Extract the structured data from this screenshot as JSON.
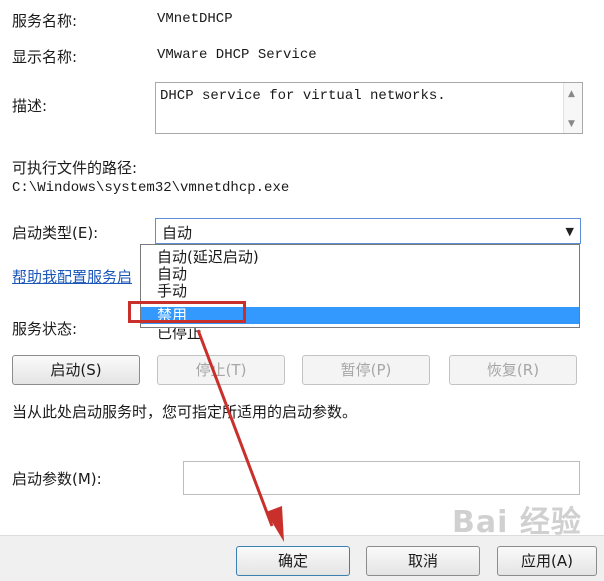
{
  "fields": {
    "service_name_label": "服务名称:",
    "service_name_value": "VMnetDHCP",
    "display_name_label": "显示名称:",
    "display_name_value": "VMware DHCP Service",
    "description_label": "描述:",
    "description_value": "DHCP service for virtual networks.",
    "path_label": "可执行文件的路径:",
    "path_value": "C:\\Windows\\system32\\vmnetdhcp.exe",
    "startup_type_label": "启动类型(E):",
    "startup_type_value": "自动",
    "help_link": "帮助我配置服务启",
    "status_label": "服务状态:",
    "status_value": "已停止"
  },
  "dropdown": {
    "options": [
      "自动(延迟启动)",
      "自动",
      "手动",
      "禁用"
    ],
    "selected_index": 3
  },
  "buttons": {
    "start": "启动(S)",
    "stop": "停止(T)",
    "pause": "暂停(P)",
    "resume": "恢复(R)"
  },
  "hint_text": "当从此处启动服务时，您可指定所适用的启动参数。",
  "param_label": "启动参数(M):",
  "param_value": "",
  "footer": {
    "ok": "确定",
    "cancel": "取消",
    "apply": "应用(A)"
  },
  "watermark": "Bai 经验",
  "colors": {
    "selection": "#3399ff",
    "highlight_box": "#c9302c",
    "arrow": "#c9302c",
    "link": "#1a57b8"
  }
}
